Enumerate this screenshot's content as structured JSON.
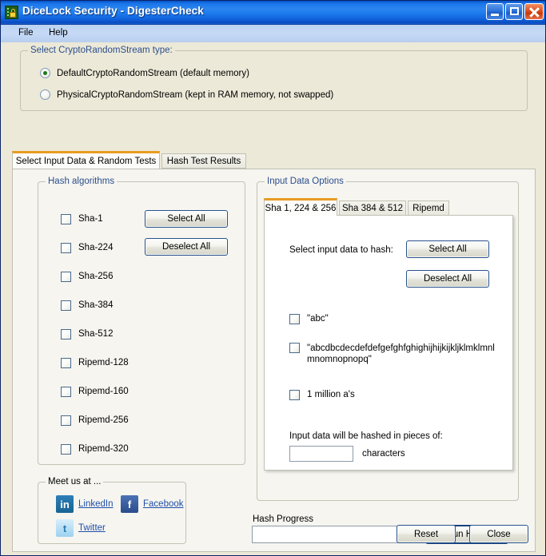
{
  "window": {
    "title": "DiceLock Security - DigesterCheck",
    "icon": "padlock-icon",
    "controls": {
      "minimize": "minimize-button",
      "maximize": "maximize-button",
      "close": "close-button"
    }
  },
  "menu": {
    "items": [
      {
        "label": "File"
      },
      {
        "label": "Help"
      }
    ]
  },
  "crypto_group": {
    "legend": "Select CryptoRandomStream type:",
    "options": [
      {
        "label": "DefaultCryptoRandomStream (default memory)",
        "checked": true
      },
      {
        "label": "PhysicalCryptoRandomStream (kept in RAM memory, not swapped)",
        "checked": false
      }
    ]
  },
  "outer_tabs": [
    {
      "label": "Select Input Data & Random Tests",
      "active": true
    },
    {
      "label": "Hash Test Results",
      "active": false
    }
  ],
  "hash_algorithms": {
    "legend": "Hash algorithms",
    "items": [
      {
        "label": "Sha-1",
        "checked": false
      },
      {
        "label": "Sha-224",
        "checked": false
      },
      {
        "label": "Sha-256",
        "checked": false
      },
      {
        "label": "Sha-384",
        "checked": false
      },
      {
        "label": "Sha-512",
        "checked": false
      },
      {
        "label": "Ripemd-128",
        "checked": false
      },
      {
        "label": "Ripemd-160",
        "checked": false
      },
      {
        "label": "Ripemd-256",
        "checked": false
      },
      {
        "label": "Ripemd-320",
        "checked": false
      }
    ],
    "select_all": "Select All",
    "deselect_all": "Deselect All"
  },
  "input_data_options": {
    "legend": "Input Data Options",
    "tabs": [
      {
        "label": "Sha 1, 224 & 256",
        "active": true
      },
      {
        "label": "Sha 384 & 512",
        "active": false
      },
      {
        "label": "Ripemd",
        "active": false
      }
    ],
    "prompt": "Select input data to hash:",
    "select_all": "Select All",
    "deselect_all": "Deselect All",
    "checkboxes": [
      {
        "label": "\"abc\"",
        "checked": false
      },
      {
        "label": "\"abcdbcdecdefdefgefghfghighijhijkijkljklmklmnlmnomnopnopq\"",
        "checked": false
      },
      {
        "label": "1 million a's",
        "checked": false
      }
    ],
    "pieces_label": "Input data will be hashed in pieces of:",
    "pieces_value": "",
    "pieces_unit": "characters"
  },
  "meet_us": {
    "legend": "Meet us at ...",
    "links": [
      {
        "label": "LinkedIn",
        "icon": "linkedin-icon",
        "glyph": "in"
      },
      {
        "label": "Facebook",
        "icon": "facebook-icon",
        "glyph": "f"
      },
      {
        "label": "Twitter",
        "icon": "twitter-icon",
        "glyph": "t"
      }
    ]
  },
  "progress": {
    "label": "Hash Progress",
    "value": "",
    "run_button": "Run Hash"
  },
  "footer": {
    "reset": "Reset",
    "close": "Close"
  },
  "colors": {
    "titlebar_blue": "#1C7AEC",
    "form_background": "#ECE9D8",
    "legend_blue": "#2B4E8C",
    "active_tab_accent": "#E89B21",
    "link_blue": "#1F4FA8",
    "close_button_red": "#C83808"
  }
}
